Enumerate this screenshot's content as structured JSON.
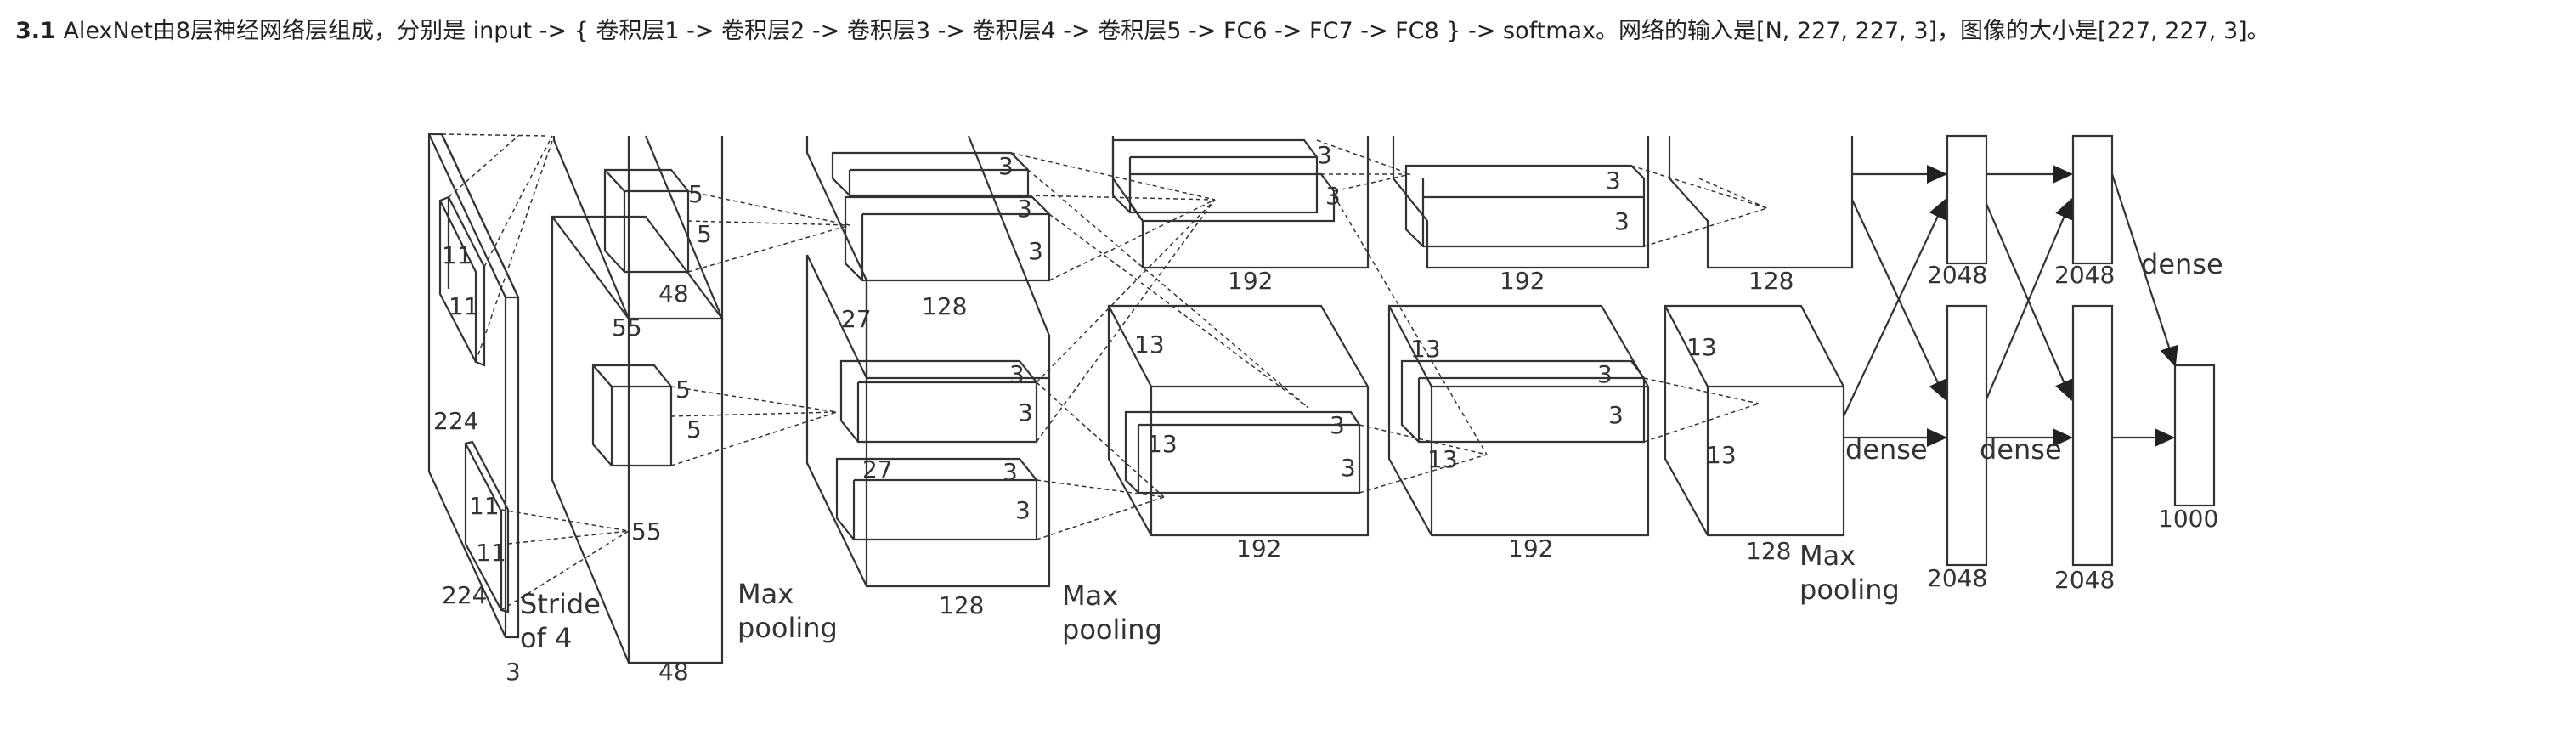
{
  "heading": {
    "number": "3.1",
    "text": "AlexNet由8层神经网络层组成，分别是 input -> { 卷积层1 -> 卷积层2 -> 卷积层3 -> 卷积层4 -> 卷积层5 -> FC6 -> FC7 -> FC8 } -> softmax。网络的输入是[N, 227, 227, 3]，图像的大小是[227, 227, 3]。"
  },
  "figure": {
    "input": {
      "size_a": "224",
      "size_b": "224",
      "depth": "3",
      "kernel_top": [
        "11",
        "11"
      ],
      "kernel_bottom": [
        "11",
        "11"
      ],
      "stride": [
        "Stride",
        "of 4"
      ]
    },
    "conv1": {
      "size": "55",
      "size_b": "55",
      "depth_top": "48",
      "depth_bottom": "48",
      "kernel": [
        "5",
        "5"
      ],
      "kernel_b": [
        "5",
        "5"
      ],
      "pool": [
        "Max",
        "pooling"
      ]
    },
    "conv2": {
      "size": "27",
      "size_b": "27",
      "depth_top": "128",
      "depth_bottom": "128",
      "kernel": "3",
      "pool": [
        "Max",
        "pooling"
      ]
    },
    "conv3": {
      "size": "13",
      "size_b": "13",
      "depth_top": "192",
      "depth_bottom": "192",
      "kernel": "3"
    },
    "conv4": {
      "size": "13",
      "size_b": "13",
      "depth_top": "192",
      "depth_bottom": "192",
      "kernel": "3"
    },
    "conv5": {
      "size": "13",
      "size_b": "13",
      "depth_top": "128",
      "depth_bottom": "128",
      "pool": [
        "Max",
        "pooling"
      ]
    },
    "fc": {
      "fc6_top": "2048",
      "fc6_bottom": "2048",
      "fc7_top": "2048",
      "fc7_bottom": "2048",
      "out": "1000",
      "dense": "dense"
    }
  }
}
